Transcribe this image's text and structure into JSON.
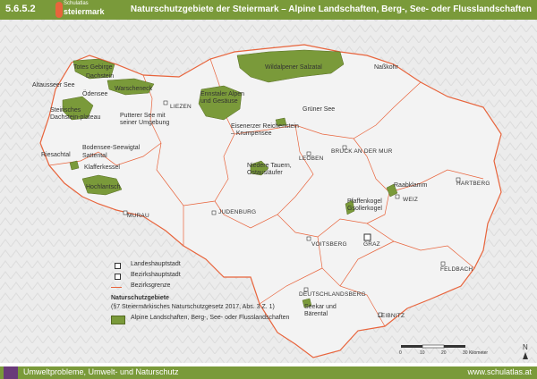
{
  "header": {
    "number": "5.6.5.2",
    "logo_line1": "Schulatlas",
    "logo_line2": "steiermark",
    "title": "Naturschutzgebiete der Steiermark – Alpine Landschaften, Berg-, See- oder Flusslandschaften"
  },
  "map_labels": {
    "protected_areas": [
      "Totes Gebirge",
      "Warscheneck",
      "Dachstein",
      "Altausseer See",
      "Ödensee",
      "Steirisches Dachstein-plateau",
      "Putterer See mit seiner Umgebung",
      "Ennstaler Alpen und Gesäuse",
      "Grüner See",
      "Wildalpener Salzatal",
      "Naßkohr",
      "Eisenerzer Reichenstein – Krumpensee",
      "Niedere Tauern, Ostausläufer",
      "Bodensee-Seewigtal",
      "Sattental",
      "Klafferkessel",
      "Hochlantsch",
      "Raabklamm",
      "Pfaffenkogel Gsollerkogel",
      "Seekar und Bärental"
    ],
    "towns": [
      "LIEZEN",
      "LEOBEN",
      "BRUCK AN DER MUR",
      "HARTBERG",
      "WEIZ",
      "JUDENBURG",
      "MURAU",
      "VOITSBERG",
      "GRAZ",
      "FELDBACH",
      "DEUTSCHLANDSBERG",
      "LEIBNITZ"
    ],
    "regions": [
      "Riesachtal"
    ]
  },
  "legend": {
    "capital": "Landeshauptstadt",
    "district_capital": "Bezirkshauptstadt",
    "district_border": "Bezirksgrenze",
    "section_title": "Naturschutzgebiete",
    "section_subtitle": "(§7 Steiermärkisches Naturschutzgesetz 2017, Abs. 3 Z. 1)",
    "area_type": "Alpine Landschaften, Berg-, See- oder Flusslandschaften"
  },
  "scalebar": {
    "ticks": [
      "0",
      "10",
      "20",
      "30 Kilometer"
    ]
  },
  "north": "N",
  "footer": {
    "text": "Umweltprobleme, Umwelt- und Naturschutz",
    "url": "www.schulatlas.at"
  },
  "colors": {
    "header_bg": "#7a9a3a",
    "border": "#e8643c",
    "protected_area": "#7a9a3a"
  }
}
